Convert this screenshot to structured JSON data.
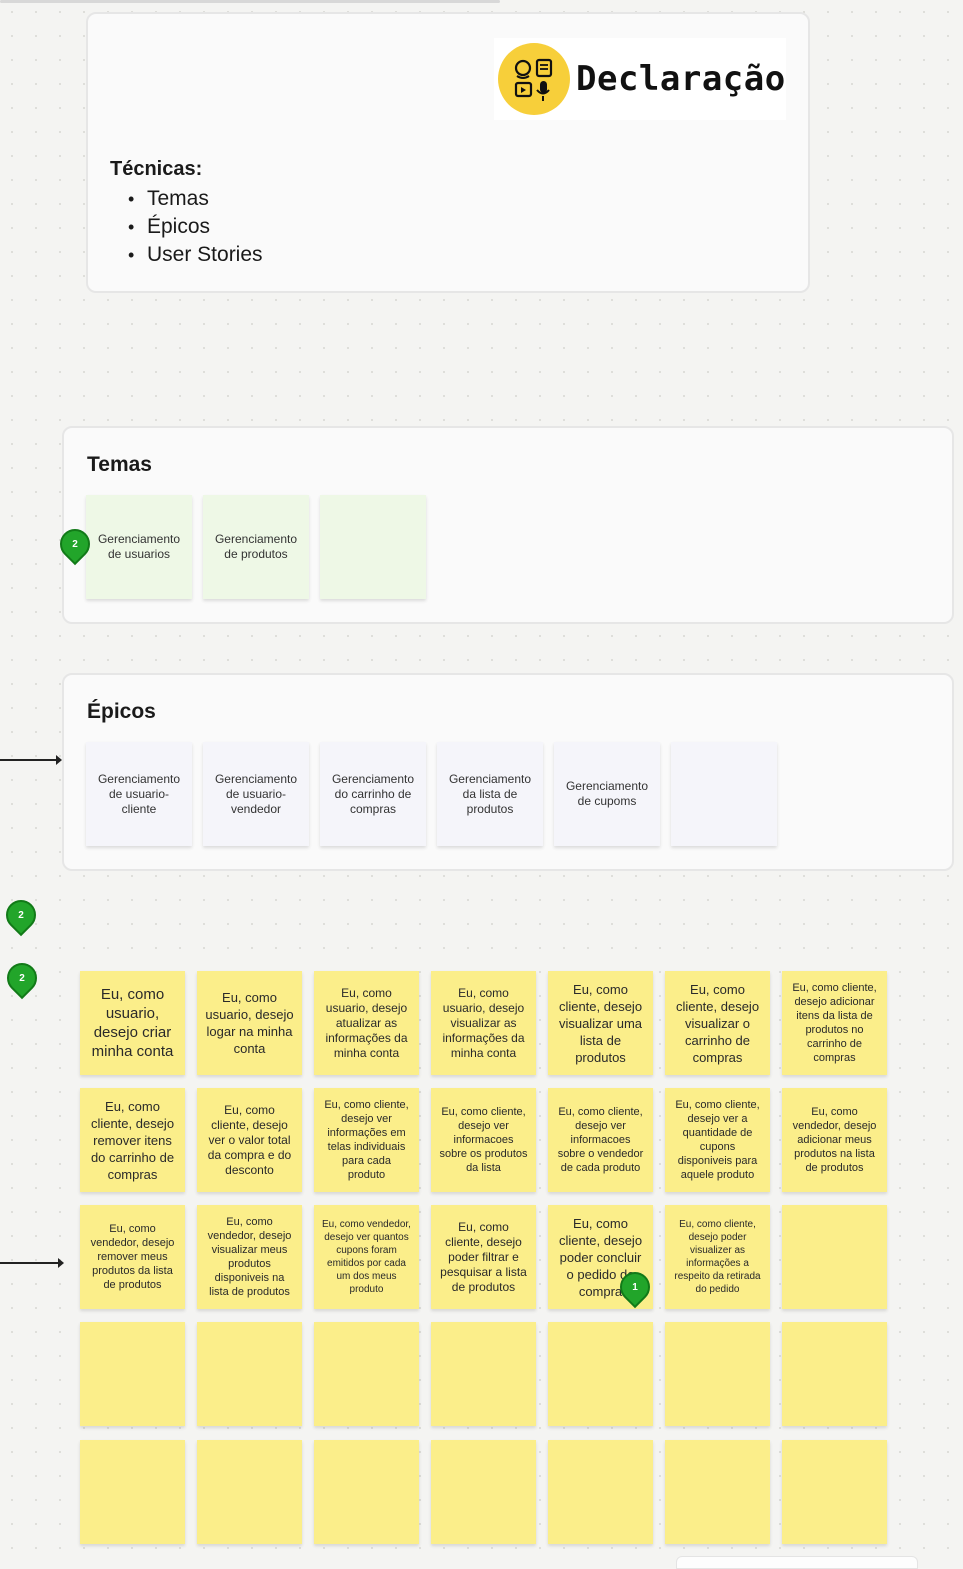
{
  "intro": {
    "logo_text": "Declaração",
    "techniques_title": "Técnicas:",
    "techniques": [
      "Temas",
      "Épicos",
      "User Stories"
    ]
  },
  "temas": {
    "title": "Temas",
    "cards": [
      "Gerenciamento de usuarios",
      "Gerenciamento de produtos",
      ""
    ]
  },
  "epicos": {
    "title": "Épicos",
    "cards": [
      "Gerenciamento de usuario-cliente",
      "Gerenciamento de usuario-vendedor",
      "Gerenciamento do carrinho de compras",
      "Gerenciamento da lista de produtos",
      "Gerenciamento de cupoms",
      ""
    ]
  },
  "stories": {
    "rows": [
      [
        "Eu, como usuario, desejo criar minha conta",
        "Eu, como usuario, desejo logar na minha conta",
        "Eu, como usuario, desejo atualizar as informações da minha conta",
        "Eu, como usuario, desejo visualizar as informações da minha conta",
        "Eu, como cliente, desejo visualizar uma lista de produtos",
        "Eu, como cliente, desejo visualizar o carrinho de compras",
        "Eu, como cliente, desejo adicionar itens da lista de produtos no carrinho de compras"
      ],
      [
        "Eu, como cliente, desejo remover itens do carrinho de compras",
        "Eu, como cliente, desejo ver o valor total da compra e do desconto",
        "Eu, como cliente, desejo ver informações em telas individuais para cada produto",
        "Eu, como cliente, desejo ver informacoes sobre os produtos da lista",
        "Eu, como cliente, desejo ver informacoes sobre o vendedor de cada produto",
        "Eu, como cliente, desejo ver a quantidade de cupons disponiveis para aquele produto",
        "Eu, como vendedor, desejo adicionar meus produtos na lista de produtos"
      ],
      [
        "Eu, como vendedor, desejo remover meus produtos da lista de produtos",
        "Eu, como vendedor, desejo visualizar meus produtos disponiveis na lista de produtos",
        "Eu, como vendedor, desejo ver quantos cupons foram emitidos por cada um dos meus produto",
        "Eu, como cliente, desejo poder filtrar e pesquisar a lista de produtos",
        "Eu, como cliente, desejo poder concluir o pedido de compra",
        "Eu, como cliente, desejo poder visualizer as informações a respeito da retirada do pedido",
        ""
      ],
      [
        "",
        "",
        "",
        "",
        "",
        "",
        ""
      ],
      [
        "",
        "",
        "",
        "",
        "",
        "",
        ""
      ]
    ]
  },
  "pins": {
    "temas": "2",
    "left_a": "2",
    "left_b": "2",
    "story": "1"
  },
  "colors": {
    "sticky_yellow": "#fbee8a",
    "theme_green": "#eef8e6",
    "epic_lavender": "#f5f5fa",
    "pin_green": "#22a52a"
  }
}
